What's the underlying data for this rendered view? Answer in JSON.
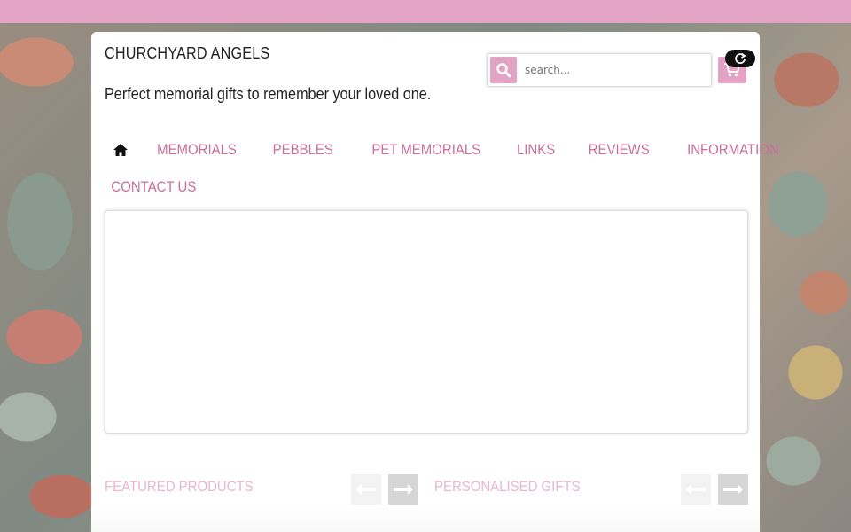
{
  "header": {
    "site_name": "CHURCHYARD ANGELS",
    "tagline": "Perfect memorial gifts to remember your loved one."
  },
  "search": {
    "placeholder": "search...",
    "value": ""
  },
  "icons": {
    "search": "search-icon",
    "cart": "cart-icon",
    "refresh": "refresh-icon",
    "home": "home-icon",
    "prev": "arrow-left-icon",
    "next": "arrow-right-icon"
  },
  "nav": {
    "items": [
      {
        "label": "MEMORIALS"
      },
      {
        "label": "PEBBLES"
      },
      {
        "label": "PET MEMORIALS"
      },
      {
        "label": "LINKS"
      },
      {
        "label": "REVIEWS"
      },
      {
        "label": "INFORMATION"
      },
      {
        "label": "CONTACT US"
      }
    ]
  },
  "sections": {
    "featured": {
      "title": "FEATURED PRODUCTS"
    },
    "personalised": {
      "title": "PERSONALISED GIFTS"
    }
  },
  "colors": {
    "accent": "#e3a3c5",
    "nav_text": "#c96e99"
  }
}
